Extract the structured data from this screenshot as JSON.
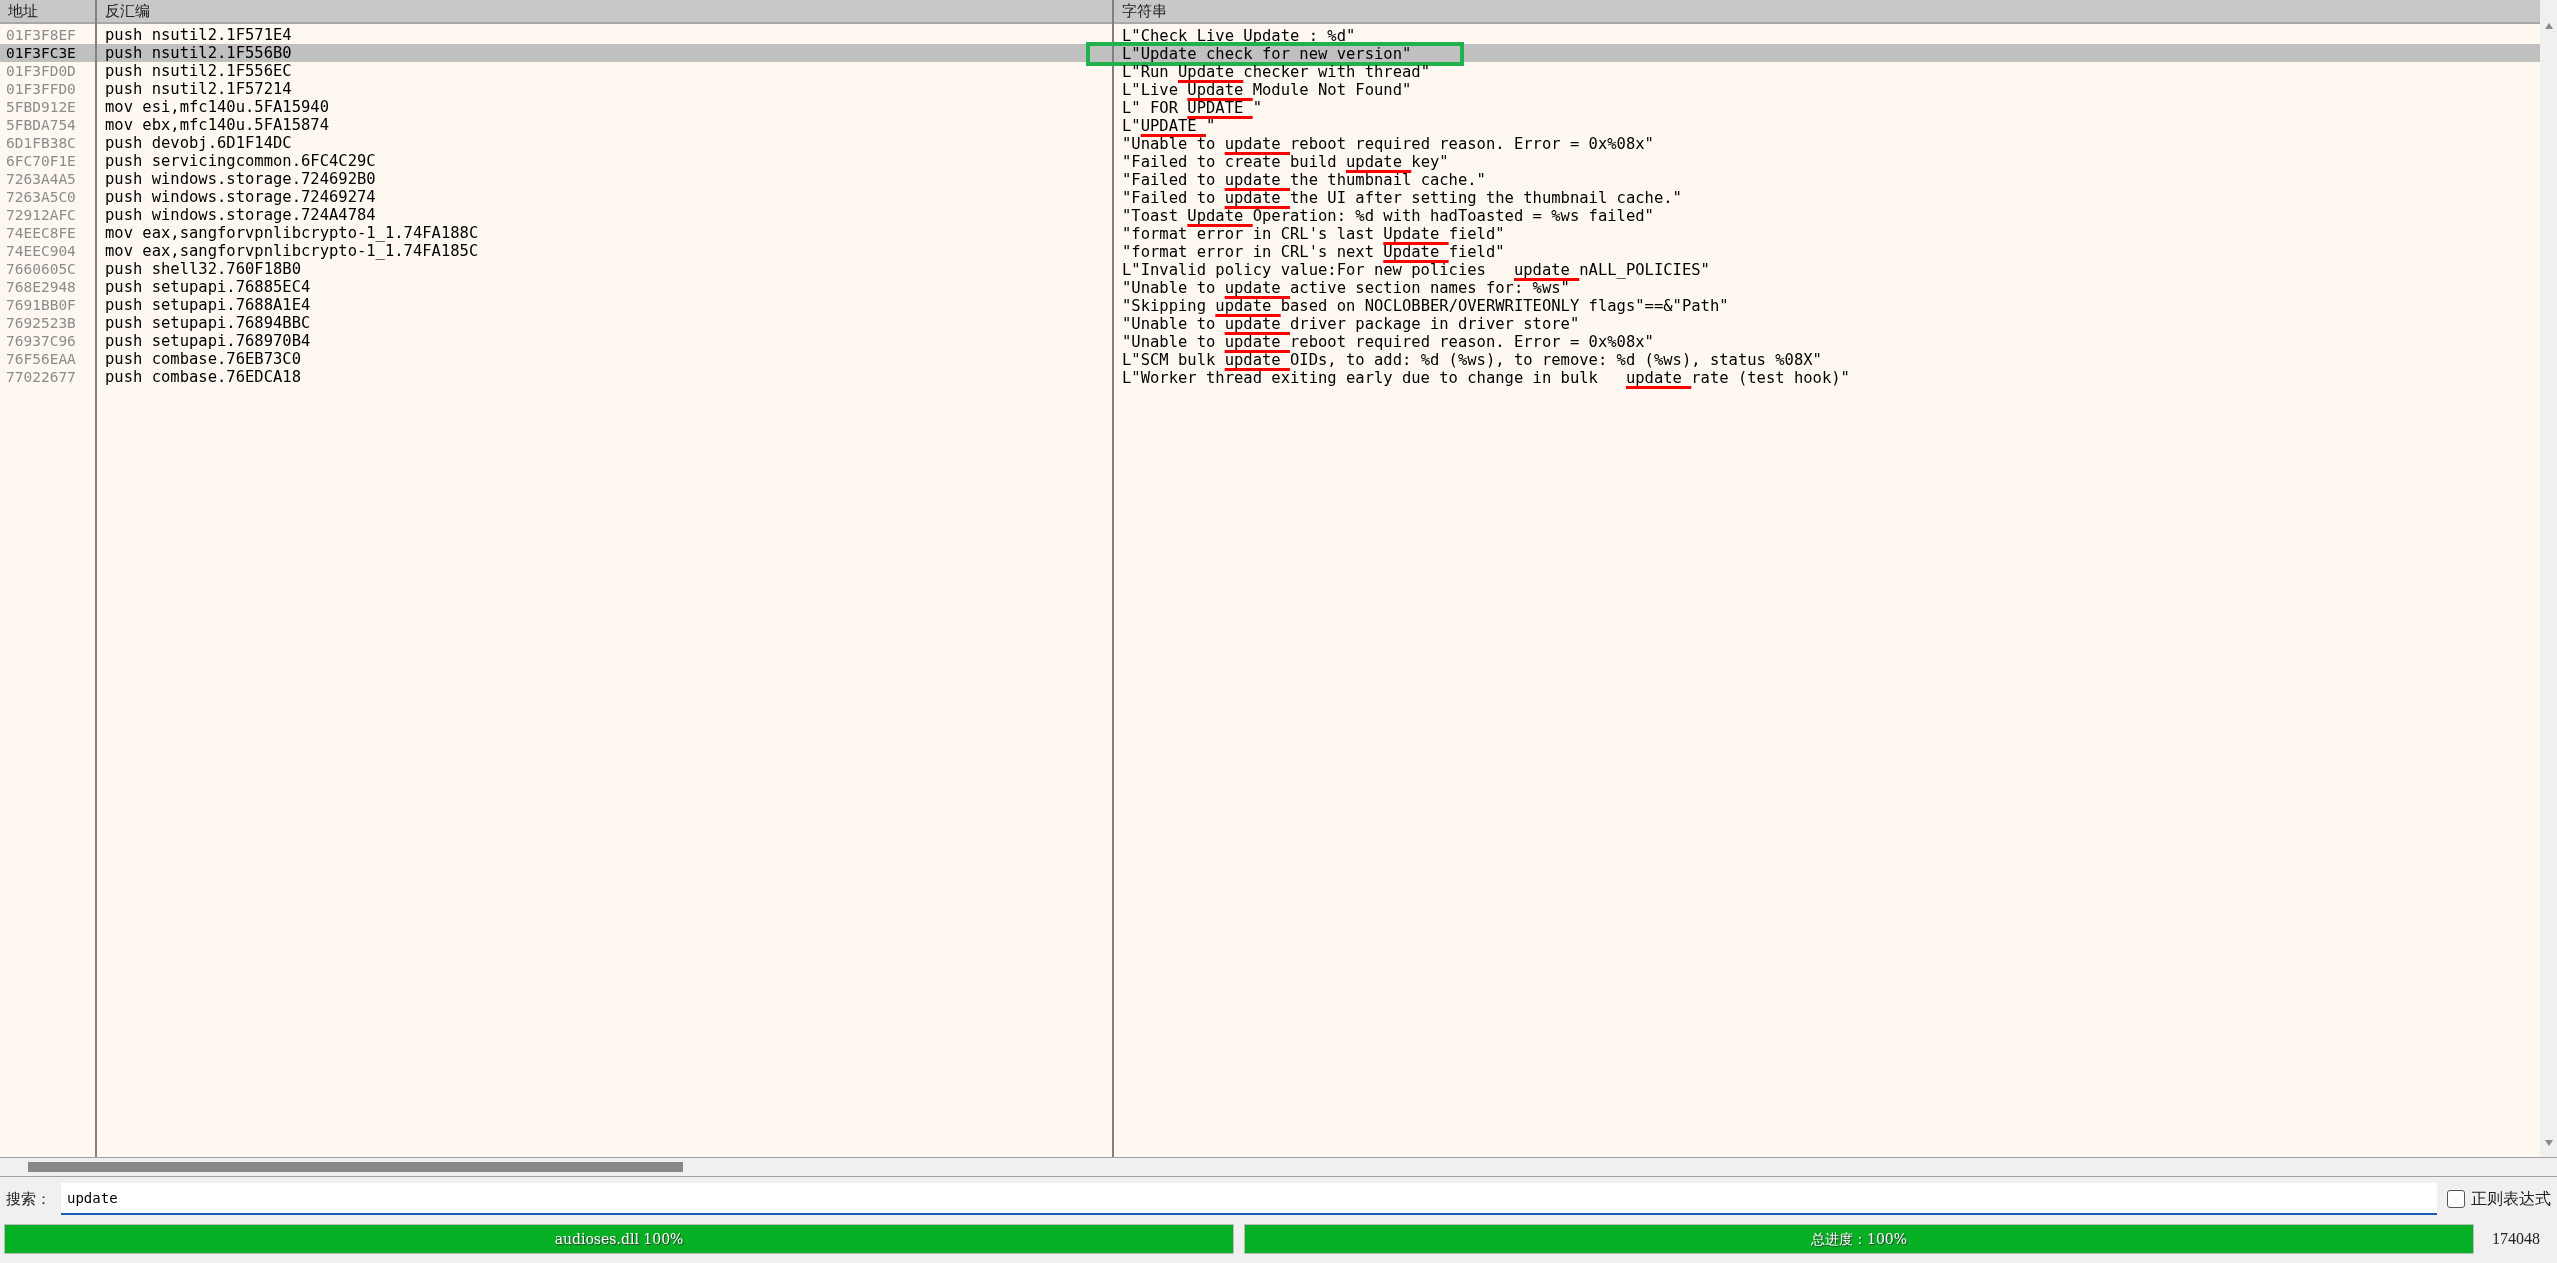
{
  "columns": [
    "地址",
    "反汇编",
    "字符串"
  ],
  "rows": [
    {
      "address": "01F3F8EF",
      "disassembly": "push nsutil2.1F571E4",
      "string": {
        "before": "L\"Check Live ",
        "match": "Update ",
        "after": ": %d\""
      },
      "selected": false,
      "boxed": false
    },
    {
      "address": "01F3FC3E",
      "disassembly": "push nsutil2.1F556B0",
      "string": {
        "before": "L\"",
        "match": "Update ",
        "after": "check for new version\""
      },
      "selected": true,
      "boxed": true
    },
    {
      "address": "01F3FD0D",
      "disassembly": "push nsutil2.1F556EC",
      "string": {
        "before": "L\"Run ",
        "match": "Update ",
        "after": "checker with thread\""
      },
      "selected": false,
      "boxed": false
    },
    {
      "address": "01F3FFD0",
      "disassembly": "push nsutil2.1F57214",
      "string": {
        "before": "L\"Live ",
        "match": "Update ",
        "after": "Module Not Found\""
      },
      "selected": false,
      "boxed": false
    },
    {
      "address": "5FBD912E",
      "disassembly": "mov esi,mfc140u.5FA15940",
      "string": {
        "before": "L\" FOR ",
        "match": "UPDATE ",
        "after": "\""
      },
      "selected": false,
      "boxed": false
    },
    {
      "address": "5FBDA754",
      "disassembly": "mov ebx,mfc140u.5FA15874",
      "string": {
        "before": "L\"",
        "match": "UPDATE ",
        "after": "\""
      },
      "selected": false,
      "boxed": false
    },
    {
      "address": "6D1FB38C",
      "disassembly": "push devobj.6D1F14DC",
      "string": {
        "before": "\"Unable to ",
        "match": "update ",
        "after": "reboot required reason. Error = 0x%08x\""
      },
      "selected": false,
      "boxed": false
    },
    {
      "address": "6FC70F1E",
      "disassembly": "push servicingcommon.6FC4C29C",
      "string": {
        "before": "\"Failed to create build ",
        "match": "update ",
        "after": "key\""
      },
      "selected": false,
      "boxed": false
    },
    {
      "address": "7263A4A5",
      "disassembly": "push windows.storage.724692B0",
      "string": {
        "before": "\"Failed to ",
        "match": "update ",
        "after": "the thumbnail cache.\""
      },
      "selected": false,
      "boxed": false
    },
    {
      "address": "7263A5C0",
      "disassembly": "push windows.storage.72469274",
      "string": {
        "before": "\"Failed to ",
        "match": "update ",
        "after": "the UI after setting the thumbnail cache.\""
      },
      "selected": false,
      "boxed": false
    },
    {
      "address": "72912AFC",
      "disassembly": "push windows.storage.724A4784",
      "string": {
        "before": "\"Toast ",
        "match": "Update ",
        "after": "Operation: %d with hadToasted = %ws failed\""
      },
      "selected": false,
      "boxed": false
    },
    {
      "address": "74EEC8FE",
      "disassembly": "mov eax,sangforvpnlibcrypto-1_1.74FA188C",
      "string": {
        "before": "\"format error in CRL's last ",
        "match": "Update ",
        "after": "field\""
      },
      "selected": false,
      "boxed": false
    },
    {
      "address": "74EEC904",
      "disassembly": "mov eax,sangforvpnlibcrypto-1_1.74FA185C",
      "string": {
        "before": "\"format error in CRL's next ",
        "match": "Update ",
        "after": "field\""
      },
      "selected": false,
      "boxed": false
    },
    {
      "address": "7660605C",
      "disassembly": "push shell32.760F18B0",
      "string": {
        "before": "L\"Invalid policy value:For new policies   ",
        "match": "update ",
        "after": "nALL_POLICIES\""
      },
      "selected": false,
      "boxed": false
    },
    {
      "address": "768E2948",
      "disassembly": "push setupapi.76885EC4",
      "string": {
        "before": "\"Unable to ",
        "match": "update ",
        "after": "active section names for: %ws\""
      },
      "selected": false,
      "boxed": false
    },
    {
      "address": "7691BB0F",
      "disassembly": "push setupapi.7688A1E4",
      "string": {
        "before": "\"Skipping ",
        "match": "update ",
        "after": "based on NOCLOBBER/OVERWRITEONLY flags\"==&\"Path\""
      },
      "selected": false,
      "boxed": false
    },
    {
      "address": "7692523B",
      "disassembly": "push setupapi.76894BBC",
      "string": {
        "before": "\"Unable to ",
        "match": "update ",
        "after": "driver package in driver store\""
      },
      "selected": false,
      "boxed": false
    },
    {
      "address": "76937C96",
      "disassembly": "push setupapi.768970B4",
      "string": {
        "before": "\"Unable to ",
        "match": "update ",
        "after": "reboot required reason. Error = 0x%08x\""
      },
      "selected": false,
      "boxed": false
    },
    {
      "address": "76F56EAA",
      "disassembly": "push combase.76EB73C0",
      "string": {
        "before": "L\"SCM bulk ",
        "match": "update ",
        "after": "OIDs, to add: %d (%ws), to remove: %d (%ws), status %08X\""
      },
      "selected": false,
      "boxed": false
    },
    {
      "address": "77022677",
      "disassembly": "push combase.76EDCA18",
      "string": {
        "before": "L\"Worker thread exiting early due to change in bulk   ",
        "match": "update ",
        "after": "rate (test hook)\""
      },
      "selected": false,
      "boxed": false
    }
  ],
  "search": {
    "label": "搜索：",
    "value": "update "
  },
  "regex": {
    "label": "正则表达式",
    "checked": false
  },
  "progress": [
    {
      "label": "audioses.dll 100%",
      "level": 1
    },
    {
      "label": "总进度：100%",
      "level": 1
    }
  ],
  "count": "174048"
}
